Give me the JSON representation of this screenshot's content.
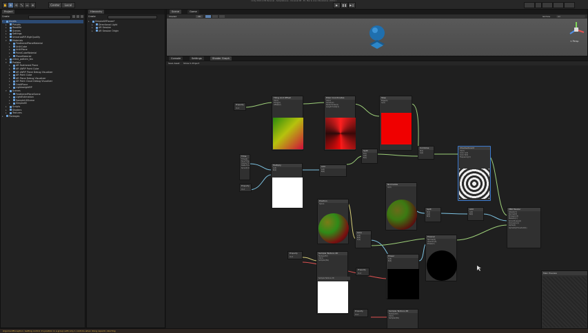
{
  "app": {
    "title": "Unity 2019.1.0f2 Personal - SampleScene - Universal RP - PC, Mac & Linux Standalone <DX11>",
    "play_controls": [
      "▶",
      "❚❚",
      "▶❙"
    ],
    "toolbar": {
      "center": "Center",
      "local": "Local",
      "tools": [
        "✋",
        "✥",
        "⟲",
        "⤡",
        "▭",
        "⊕"
      ]
    }
  },
  "project_panel": {
    "tab": "Project",
    "create": "Create",
    "favorites": "Favorites",
    "tree": [
      {
        "label": "Assets",
        "depth": 0,
        "open": true
      },
      {
        "label": "Presets",
        "depth": 1
      },
      {
        "label": "ReadMe",
        "depth": 1
      },
      {
        "label": "Scenes",
        "depth": 1
      },
      {
        "label": "Settings",
        "depth": 1
      },
      {
        "label": "UniversalRP-HighQuality",
        "depth": 1
      },
      {
        "label": "Materials",
        "depth": 1,
        "open": true
      },
      {
        "label": "FeatheredPlaneMaterial",
        "depth": 2
      },
      {
        "label": "UnlitCube",
        "depth": 2
      },
      {
        "label": "UnlitPlane",
        "depth": 2
      },
      {
        "label": "PointCubeMaterial",
        "depth": 2
      },
      {
        "label": "PlaneMaterial",
        "depth": 2
      },
      {
        "label": "zebra_pattern_tex",
        "depth": 1
      },
      {
        "label": "Prefabs",
        "depth": 1,
        "open": true
      },
      {
        "label": "AR Feathered Plane",
        "depth": 2
      },
      {
        "label": "AR LWRP Point Cube",
        "depth": 2
      },
      {
        "label": "AR LWRP Plane Debug Visualizer",
        "depth": 2
      },
      {
        "label": "AR Point Cube",
        "depth": 2
      },
      {
        "label": "AR Plane Debug Visualizer",
        "depth": 2
      },
      {
        "label": "AR Point Cloud Debug Visualizer",
        "depth": 2
      },
      {
        "label": "OrbitPlane",
        "depth": 2
      },
      {
        "label": "LightweightRP",
        "depth": 2
      },
      {
        "label": "Scenes",
        "depth": 1,
        "open": true
      },
      {
        "label": "FeatheredPlaneScene",
        "depth": 2
      },
      {
        "label": "LightEstimation",
        "depth": 2
      },
      {
        "label": "SampleUXScene",
        "depth": 2
      },
      {
        "label": "SimpleAR",
        "depth": 2
      },
      {
        "label": "Scripts",
        "depth": 1
      },
      {
        "label": "Shaders",
        "depth": 1
      },
      {
        "label": "Textures",
        "depth": 1
      },
      {
        "label": "Packages",
        "depth": 0
      }
    ],
    "selected_index": 0
  },
  "hierarchy_panel": {
    "tab": "Hierarchy",
    "create": "Create",
    "tree": [
      {
        "label": "SimpleARPlanes*",
        "depth": 0
      },
      {
        "label": "Directional Light",
        "depth": 1
      },
      {
        "label": "AR Session",
        "depth": 1
      },
      {
        "label": "AR Session Origin",
        "depth": 1
      }
    ]
  },
  "scene_panel": {
    "tabs": [
      "Scene",
      "Game"
    ],
    "shading": "Shaded",
    "mode_2d": "2D",
    "gizmos": "Gizmos",
    "search": "All",
    "persp_label": "< Persp"
  },
  "bottom_tabs": [
    "Console",
    "Settings",
    "Shader Graph"
  ],
  "graph_toolbar": [
    "Save Asset",
    "Show In Project"
  ],
  "nodes": [
    {
      "id": "tiling",
      "title": "Tiling And Offset",
      "ports": [
        "UV(2)",
        "Tiling(2)",
        "Offset(2)"
      ]
    },
    {
      "id": "polar",
      "title": "Polar Coordinates",
      "ports": [
        "UV(2)",
        "Center(2)",
        "Radial Scale(1)",
        "Length Scale(1)"
      ]
    },
    {
      "id": "step",
      "title": "Step",
      "ports": [
        "Edge(4)",
        "In(4)"
      ]
    },
    {
      "id": "property1",
      "title": "Property",
      "ports": [
        "Out"
      ]
    },
    {
      "id": "time",
      "title": "Time",
      "ports": [
        "Time(1)",
        "Sine Time(1)",
        "Cosine Time(1)",
        "Delta Time(1)",
        "Smooth Delta(1)"
      ]
    },
    {
      "id": "property2",
      "title": "Property",
      "ports": [
        "Out"
      ]
    },
    {
      "id": "multiply",
      "title": "Multiply",
      "ports": [
        "A(4)",
        "B(4)"
      ]
    },
    {
      "id": "add1",
      "title": "Add",
      "ports": [
        "A(4)",
        "B(4)"
      ]
    },
    {
      "id": "split1",
      "title": "Split",
      "ports": [
        "In(4)",
        "R(1)",
        "G(1)",
        "B(1)"
      ]
    },
    {
      "id": "combine",
      "title": "Combine",
      "ports": [
        "R(1)",
        "G(1)",
        "B(1)",
        "A(1)"
      ]
    },
    {
      "id": "checker",
      "title": "Checkerboard",
      "ports": [
        "UV(2)",
        "Color A(3)",
        "Color B(3)",
        "Frequency(2)"
      ]
    },
    {
      "id": "normalize",
      "title": "Normalize",
      "ports": [
        "In(3)"
      ]
    },
    {
      "id": "position",
      "title": "Position",
      "ports": [
        "Space"
      ]
    },
    {
      "id": "split2",
      "title": "Split",
      "ports": [
        "In(4)",
        "R(1)",
        "G(1)",
        "B(1)"
      ]
    },
    {
      "id": "add2",
      "title": "Add",
      "ports": [
        "A(4)",
        "B(4)"
      ]
    },
    {
      "id": "lerp",
      "title": "Lerp",
      "ports": [
        "A(4)",
        "B(4)",
        "T(4)"
      ]
    },
    {
      "id": "master",
      "title": "PBR Master",
      "ports": [
        "Albedo(3)",
        "Normal(3)",
        "Emission(3)",
        "Metallic(1)",
        "Smoothness(1)",
        "Occlusion(1)",
        "Alpha(1)",
        "AlphaClipThreshold(1)"
      ]
    },
    {
      "id": "property3",
      "title": "Property",
      "ports": [
        "Out"
      ]
    },
    {
      "id": "sample",
      "title": "Sample Texture 2D",
      "ports": [
        "Texture(T2)",
        "UV(2)",
        "Sampler(SS)"
      ]
    },
    {
      "id": "power",
      "title": "Power",
      "ports": [
        "A(4)",
        "B(4)"
      ]
    },
    {
      "id": "fresnel",
      "title": "Fresnel",
      "ports": [
        "Normal(3)",
        "View Dir(3)",
        "Power(1)"
      ]
    },
    {
      "id": "property4",
      "title": "Property",
      "ports": [
        "Out"
      ]
    },
    {
      "id": "sample2",
      "title": "Sample Texture 2D",
      "ports": [
        "Texture(T2)",
        "UV(2)",
        "Sampler(SS)"
      ]
    },
    {
      "id": "property5",
      "title": "Property",
      "ports": [
        "Out"
      ]
    },
    {
      "id": "multiply2",
      "title": "Multiply",
      "ports": [
        "A(4)",
        "B(4)"
      ]
    }
  ],
  "main_preview": {
    "title": "Main Preview"
  },
  "colors": {
    "accent": "#3b7bd1",
    "wire_green": "#9ed07a",
    "wire_blue": "#7fc6e6",
    "wire_yellow": "#d8d07a"
  },
  "status": {
    "message": "ArgumentException: Getting control 1's position in a group with only 1 controls when doing repaint. Aborting"
  }
}
